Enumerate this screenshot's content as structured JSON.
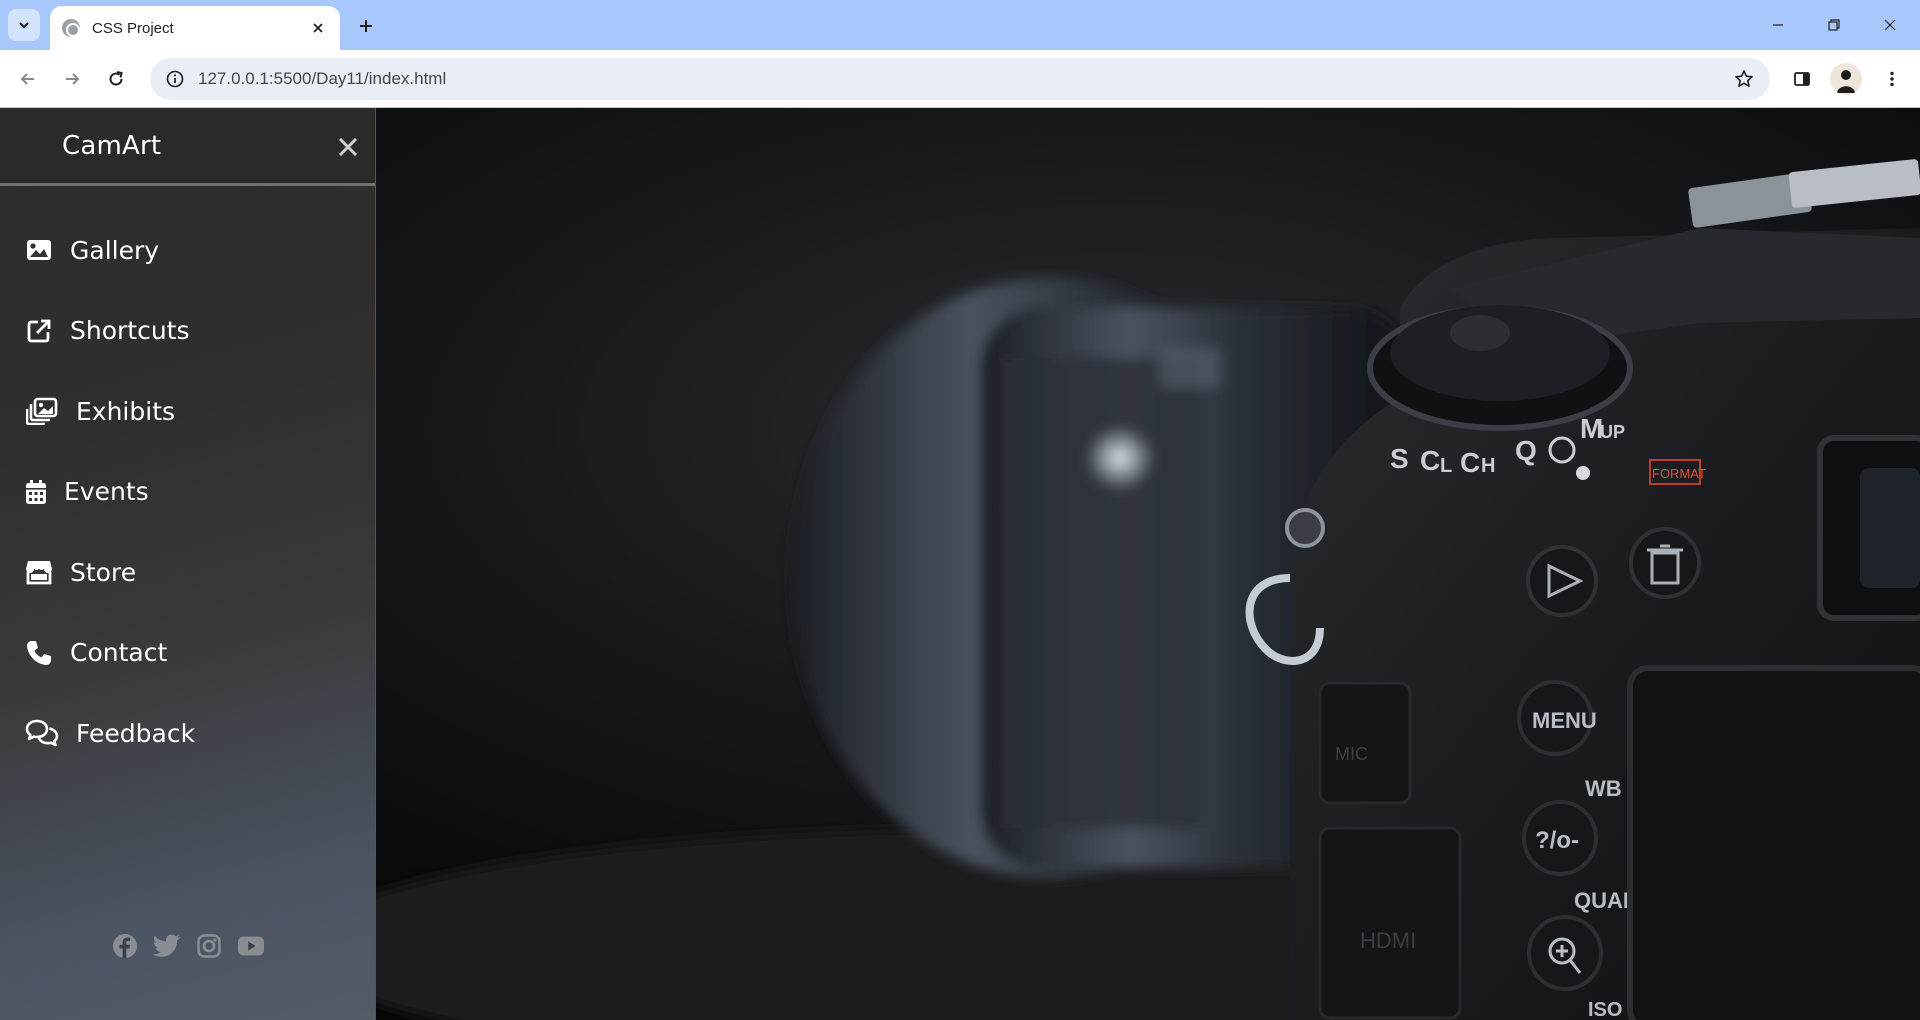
{
  "browser": {
    "tab_title": "CSS Project",
    "url": "127.0.0.1:5500/Day11/index.html"
  },
  "sidebar": {
    "brand": "CamArt",
    "items": [
      {
        "label": "Gallery",
        "icon": "image-icon"
      },
      {
        "label": "Shortcuts",
        "icon": "external-link-icon"
      },
      {
        "label": "Exhibits",
        "icon": "photo-stack-icon"
      },
      {
        "label": "Events",
        "icon": "calendar-icon"
      },
      {
        "label": "Store",
        "icon": "store-icon"
      },
      {
        "label": "Contact",
        "icon": "phone-icon"
      },
      {
        "label": "Feedback",
        "icon": "chat-bubbles-icon"
      }
    ],
    "social": [
      "facebook-icon",
      "twitter-icon",
      "instagram-icon",
      "youtube-icon"
    ]
  },
  "camera": {
    "dial_marks": [
      "S",
      "C",
      "L",
      "C",
      "H",
      "Q",
      "M",
      "UP"
    ],
    "format_label": "FORMAT",
    "menu_button": "MENU",
    "wb_label": "WB",
    "key_button": "?/o-",
    "qual_label": "QUAL",
    "iso_label": "ISO",
    "port_label": "HDMI",
    "mic_label": "MIC"
  },
  "colors": {
    "tabstrip": "#a8c7fa",
    "sidebar_top": "#2c2c2b",
    "sidebar_bottom": "#525b66",
    "text": "#ffffff"
  }
}
